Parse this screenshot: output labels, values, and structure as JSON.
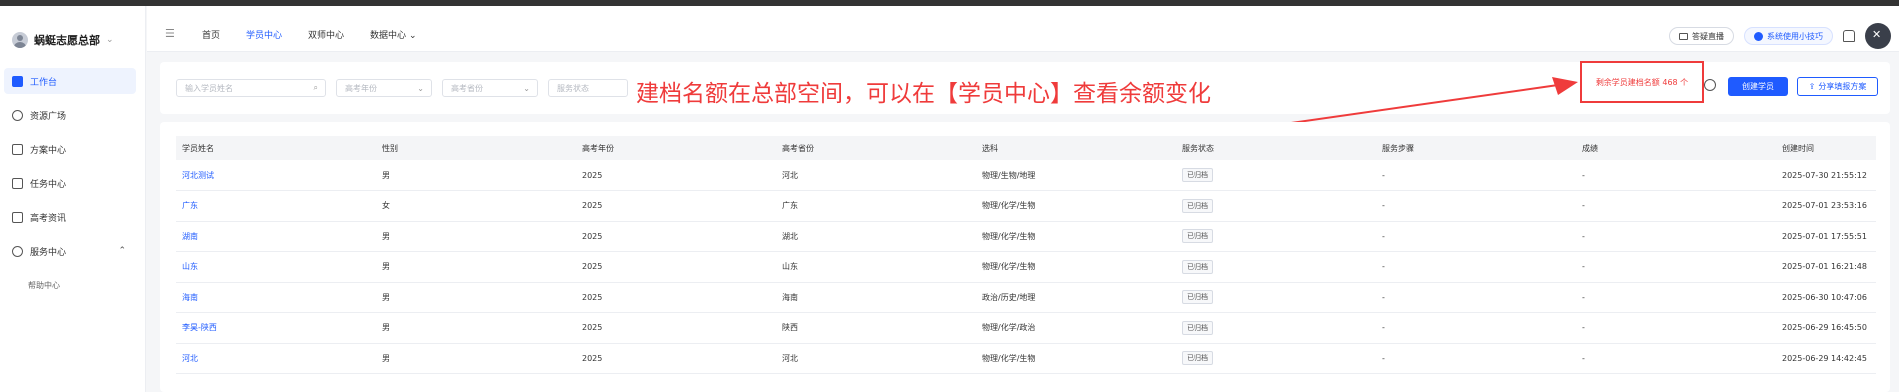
{
  "sidebar": {
    "org_name": "蜗蜓志愿总部",
    "items": [
      {
        "label": "工作台",
        "icon": "dashboard-icon",
        "active": true
      },
      {
        "label": "资源广场",
        "icon": "resource-icon"
      },
      {
        "label": "方案中心",
        "icon": "book-icon"
      },
      {
        "label": "任务中心",
        "icon": "task-icon"
      },
      {
        "label": "高考资讯",
        "icon": "news-icon"
      },
      {
        "label": "服务中心",
        "icon": "service-icon"
      }
    ],
    "sub_items": [
      {
        "label": "帮助中心"
      }
    ]
  },
  "header": {
    "nav": [
      {
        "label": "首页"
      },
      {
        "label": "学员中心",
        "active": true
      },
      {
        "label": "双师中心"
      },
      {
        "label": "数据中心"
      }
    ],
    "live_label": "答疑直播",
    "tips_label": "系统使用小技巧"
  },
  "filters": {
    "name_placeholder": "输入学员姓名",
    "year_placeholder": "高考年份",
    "province_placeholder": "高考省份",
    "status_placeholder": "服务状态"
  },
  "annotation": "建档名额在总部空间，可以在【学员中心】查看余额变化",
  "quota_text": "剩余学员建档名额 468 个",
  "actions": {
    "create_label": "创建学员",
    "share_label": "分享填报方案"
  },
  "table": {
    "headers": [
      "学员姓名",
      "性别",
      "高考年份",
      "高考省份",
      "选科",
      "服务状态",
      "服务步骤",
      "成绩",
      "创建时间"
    ],
    "rows": [
      [
        "河北测试",
        "男",
        "2025",
        "河北",
        "物理/生物/地理",
        "已归档",
        "-",
        "-",
        "2025-07-30 21:55:12"
      ],
      [
        "广东",
        "女",
        "2025",
        "广东",
        "物理/化学/生物",
        "已归档",
        "-",
        "-",
        "2025-07-01 23:53:16"
      ],
      [
        "湖南",
        "男",
        "2025",
        "湖北",
        "物理/化学/生物",
        "已归档",
        "-",
        "-",
        "2025-07-01 17:55:51"
      ],
      [
        "山东",
        "男",
        "2025",
        "山东",
        "物理/化学/生物",
        "已归档",
        "-",
        "-",
        "2025-07-01 16:21:48"
      ],
      [
        "海南",
        "男",
        "2025",
        "海南",
        "政治/历史/地理",
        "已归档",
        "-",
        "-",
        "2025-06-30 10:47:06"
      ],
      [
        "李昊-陕西",
        "男",
        "2025",
        "陕西",
        "物理/化学/政治",
        "已归档",
        "-",
        "-",
        "2025-06-29 16:45:50"
      ],
      [
        "河北",
        "男",
        "2025",
        "河北",
        "物理/化学/生物",
        "已归档",
        "-",
        "-",
        "2025-06-29 14:42:45"
      ]
    ]
  },
  "colors": {
    "accent": "#1f5bff",
    "annotation": "#ef3b3b"
  }
}
